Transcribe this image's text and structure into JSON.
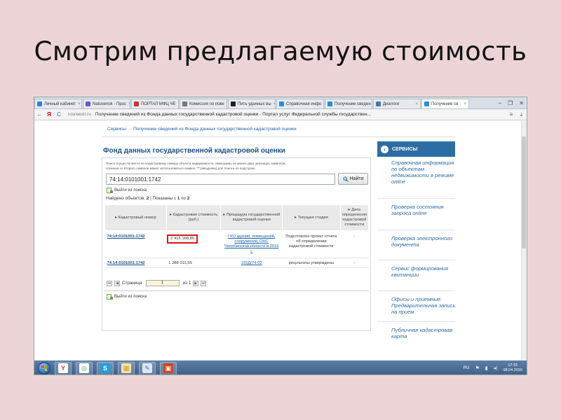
{
  "slide_title": "Смотрим предлагаемую стоимость",
  "browser": {
    "tabs": [
      {
        "label": "Личный кабинет",
        "favicon_color": "#3b7dd8"
      },
      {
        "label": "Natusenok - Прос",
        "favicon_color": "#6a5acd"
      },
      {
        "label": "ПОРТАЛ МФЦ ЧЕ",
        "favicon_color": "#d03030"
      },
      {
        "label": "Комиссия по пове",
        "favicon_color": "#777777"
      },
      {
        "label": "Пить удачных вы",
        "favicon_color": "#222222"
      },
      {
        "label": "Справочная инфо",
        "favicon_color": "#2a8fd0"
      },
      {
        "label": "Получение сведен",
        "favicon_color": "#2a8fd0"
      },
      {
        "label": "Диалоги",
        "favicon_color": "#4a76a8"
      },
      {
        "label": "Получение св",
        "favicon_color": "#2a8fd0"
      }
    ],
    "window_controls": {
      "minimize": "–",
      "restore": "❐",
      "close": "✕"
    },
    "address": {
      "back": "←",
      "yandex": "Я",
      "reload": "C",
      "host": "rosreestr.ru",
      "page_title": "Получение сведений из Фонда данных государственной кадастровой оценки - Портал услуг Федеральной службы государствен...",
      "menu_icon": "≡",
      "download_icon": "⤓"
    }
  },
  "page": {
    "breadcrumb": {
      "root": "Сервисы",
      "separator": "-",
      "current": "Получение сведений из Фонда данных государственной кадастровой оценки"
    },
    "title": "Фонд данных государственной кадастровой оценки",
    "hint": [
      "Поиск осуществляется по кадастровому номеру объекта недвижимости, имеющему не менее двух значащих символов.",
      "Начиная со второго символа может использоваться символ \"*\"(звёздочка) для поиска по подстроке."
    ],
    "search": {
      "value": "74:14:0101001:1742",
      "button_label": "Найти"
    },
    "exit_search_label": "Выйти из поиска",
    "found": {
      "prefix": "Найдено объектов:",
      "count": "2",
      "shown_prefix": "| Показаны с",
      "from": "1",
      "to_word": "по",
      "to": "2"
    },
    "table": {
      "columns": [
        "▸ Кадастровый номер",
        "▸ Кадастровая стоимость (руб.)",
        "▸ Процедура государственной кадастровой оценки",
        "▸ Текущая стадия",
        "▸ Дата определения кадастровой стоимости"
      ],
      "rows": [
        {
          "cadastral": "74:14:0101001:1742",
          "value": "2 415 168,80",
          "procedure": "ГКО зданий, помещений, сооружений, ОНС Челябинской области в 2015 г.",
          "stage": "Подготовлен проект отчета об определении кадастровой стоимости",
          "date": "-"
        },
        {
          "cadastral": "74:14:0101001:1742",
          "value": "1 288 011,55",
          "procedure": "155Д/74-02",
          "stage": "результаты утверждены",
          "date": "-"
        }
      ]
    },
    "pager": {
      "page_label": "Страница",
      "page_value": "1",
      "of_label": "из 1"
    }
  },
  "services": {
    "header": "СЕРВИСЫ",
    "items": [
      "Справочная информация по объектам недвижимости в режиме online",
      "Проверка состояния запроса online",
      "Проверка электронного документа",
      "Сервис формирования квитанции",
      "Офисы и приемные. Предварительная запись на прием",
      "Публичная кадастровая карта"
    ]
  },
  "taskbar": {
    "apps": [
      {
        "name": "yandex-browser",
        "glyph": "Y",
        "color": "#e03030",
        "bg": "#ffffff"
      },
      {
        "name": "chat-app",
        "glyph": "◎",
        "color": "#2a9d3a",
        "bg": "#ffffff"
      },
      {
        "name": "skype",
        "glyph": "S",
        "color": "#ffffff",
        "bg": "#1da0e0"
      },
      {
        "name": "folder",
        "glyph": "▦",
        "color": "#c99a2e",
        "bg": "#f6e2a6"
      },
      {
        "name": "paint",
        "glyph": "✎",
        "color": "#3a6fb0",
        "bg": "#dde8f4"
      },
      {
        "name": "presentation",
        "glyph": "▣",
        "color": "#ffffff",
        "bg": "#d2471f"
      }
    ],
    "tray": {
      "lang": "RU",
      "time": "17:15",
      "date": "08.04.2016"
    }
  }
}
